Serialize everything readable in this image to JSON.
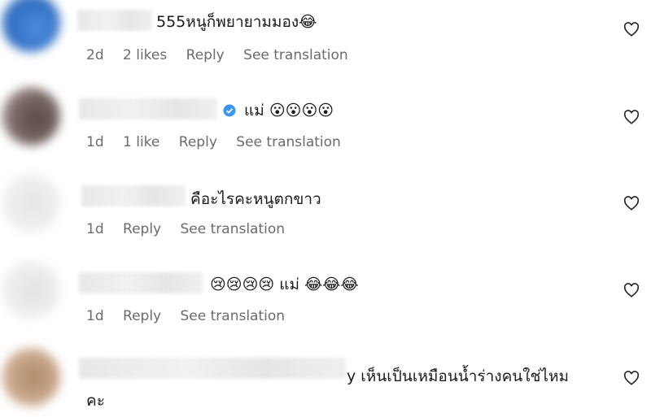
{
  "colors": {
    "text": "#262626",
    "muted": "#6b6b6b",
    "verified": "#3897f0"
  },
  "comments": [
    {
      "text": "555หนูก็พยายามมอง😂",
      "age": "2d",
      "likes": "2 likes",
      "reply": "Reply",
      "translate": "See translation"
    },
    {
      "text": "แม่ 😮😮😮😮",
      "age": "1d",
      "likes": "1 like",
      "reply": "Reply",
      "translate": "See translation"
    },
    {
      "text": "คือะไรคะหนูตกขาว",
      "age": "1d",
      "reply": "Reply",
      "translate": "See translation"
    },
    {
      "text": "😢😢😢😢 แม่ 😂😂😂",
      "age": "1d",
      "reply": "Reply",
      "translate": "See translation"
    },
    {
      "text_line1": "y เห็นเป็นเหมือนน้ำร่างคนใช่ไหม",
      "text_line2": "คะ"
    }
  ],
  "icons": {
    "like": "heart-outline-icon",
    "verified": "verified-badge-icon"
  }
}
